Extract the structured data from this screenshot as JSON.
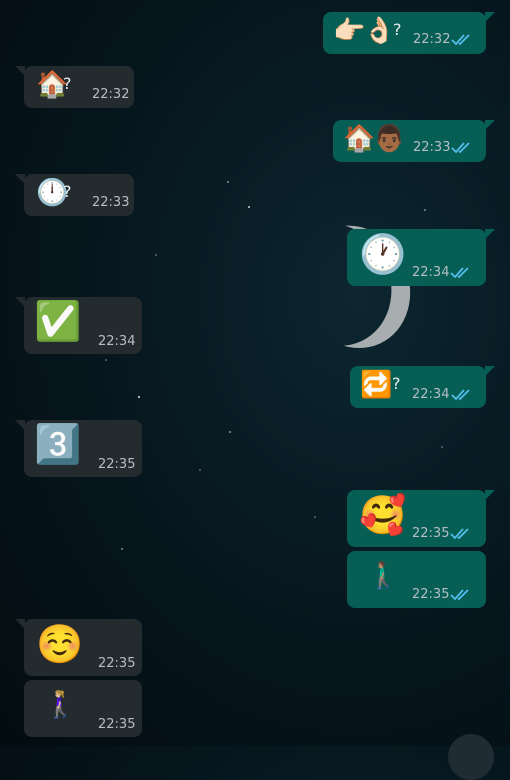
{
  "chat": {
    "background": "starry-night-with-crescent-moon",
    "messages": [
      {
        "direction": "out",
        "emoji": [
          "👉🏻",
          "👌🏻"
        ],
        "suffix": "?",
        "time": "22:32",
        "status": "read"
      },
      {
        "direction": "in",
        "emoji": [
          "🏠"
        ],
        "suffix": "?",
        "time": "22:32"
      },
      {
        "direction": "out",
        "emoji": [
          "🏠",
          "👨🏾"
        ],
        "suffix": "",
        "time": "22:33",
        "status": "read"
      },
      {
        "direction": "in",
        "emoji": [
          "🕛"
        ],
        "suffix": "?",
        "time": "22:33"
      },
      {
        "direction": "out",
        "emoji": [
          "🕐"
        ],
        "suffix": "",
        "time": "22:34",
        "status": "read"
      },
      {
        "direction": "in",
        "emoji": [
          "✅"
        ],
        "suffix": "",
        "time": "22:34"
      },
      {
        "direction": "out",
        "emoji": [
          "🔁"
        ],
        "suffix": "?",
        "time": "22:34",
        "status": "read"
      },
      {
        "direction": "in",
        "emoji": [
          "3️⃣"
        ],
        "suffix": "",
        "time": "22:35"
      },
      {
        "direction": "out",
        "emoji": [
          "🥰"
        ],
        "suffix": "",
        "time": "22:35",
        "status": "read"
      },
      {
        "direction": "out",
        "emoji": [
          "🚶🏽‍♂️"
        ],
        "suffix": "",
        "time": "22:35",
        "status": "read"
      },
      {
        "direction": "in",
        "emoji": [
          "☺️"
        ],
        "suffix": "",
        "time": "22:35"
      },
      {
        "direction": "in",
        "emoji": [
          "🚶🏼‍♀️"
        ],
        "suffix": "",
        "time": "22:35"
      }
    ],
    "colors": {
      "incoming_bubble": "#242b2e",
      "outgoing_bubble": "#075e54",
      "read_ticks": "#53bdeb",
      "time_text": "#b4bec3"
    },
    "icons": {
      "read_status": "double-check-icon",
      "scroll_button": "scroll-to-bottom-button"
    }
  }
}
